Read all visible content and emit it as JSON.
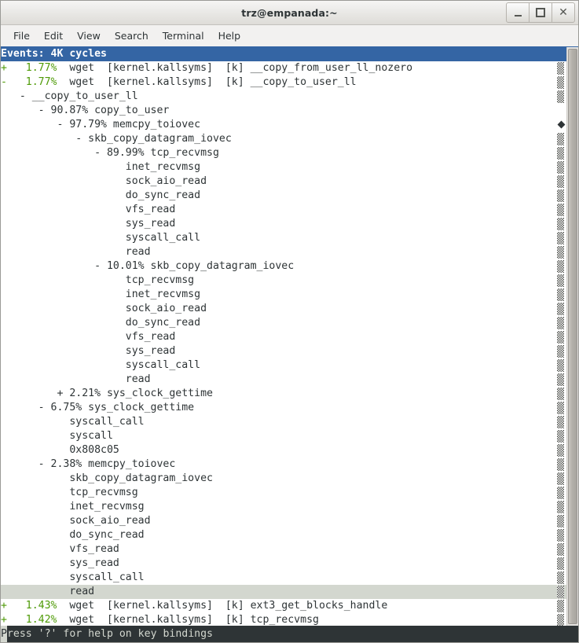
{
  "window": {
    "title": "trz@empanada:~",
    "controls": [
      {
        "name": "minimize",
        "label": "–"
      },
      {
        "name": "maximize",
        "label": "□"
      },
      {
        "name": "close",
        "label": "✕"
      }
    ]
  },
  "menubar": {
    "items": [
      "File",
      "Edit",
      "View",
      "Search",
      "Terminal",
      "Help"
    ]
  },
  "colors": {
    "header_bg": "#3465a4",
    "header_fg": "#ffffff",
    "percent_green": "#4e9a06",
    "selected_row_bg": "#d3d7cf",
    "terminal_bg": "#ffffff",
    "terminal_fg": "#2e3436",
    "statusbar_bg": "#2e3436",
    "statusbar_fg": "#d3d7cf"
  },
  "terminal": {
    "header": "Events: 4K cycles",
    "rows": [
      {
        "marker": "+",
        "percent": "1.77%",
        "text": "  wget  [kernel.kallsyms]  [k] __copy_from_user_ll_nozero",
        "indicator": "dither"
      },
      {
        "marker": "-",
        "percent": "1.77%",
        "text": "  wget  [kernel.kallsyms]  [k] __copy_to_user_ll",
        "indicator": "dither"
      },
      {
        "marker": "",
        "percent": "",
        "text": "   - __copy_to_user_ll",
        "indicator": "dither"
      },
      {
        "marker": "",
        "percent": "",
        "text": "      - 90.87% copy_to_user",
        "indicator": "none"
      },
      {
        "marker": "",
        "percent": "",
        "text": "         - 97.79% memcpy_toiovec",
        "indicator": "diamond"
      },
      {
        "marker": "",
        "percent": "",
        "text": "            - skb_copy_datagram_iovec",
        "indicator": "dither"
      },
      {
        "marker": "",
        "percent": "",
        "text": "               - 89.99% tcp_recvmsg",
        "indicator": "dither"
      },
      {
        "marker": "",
        "percent": "",
        "text": "                    inet_recvmsg",
        "indicator": "dither"
      },
      {
        "marker": "",
        "percent": "",
        "text": "                    sock_aio_read",
        "indicator": "dither"
      },
      {
        "marker": "",
        "percent": "",
        "text": "                    do_sync_read",
        "indicator": "dither"
      },
      {
        "marker": "",
        "percent": "",
        "text": "                    vfs_read",
        "indicator": "dither"
      },
      {
        "marker": "",
        "percent": "",
        "text": "                    sys_read",
        "indicator": "dither"
      },
      {
        "marker": "",
        "percent": "",
        "text": "                    syscall_call",
        "indicator": "dither"
      },
      {
        "marker": "",
        "percent": "",
        "text": "                    read",
        "indicator": "dither"
      },
      {
        "marker": "",
        "percent": "",
        "text": "               - 10.01% skb_copy_datagram_iovec",
        "indicator": "dither"
      },
      {
        "marker": "",
        "percent": "",
        "text": "                    tcp_recvmsg",
        "indicator": "dither"
      },
      {
        "marker": "",
        "percent": "",
        "text": "                    inet_recvmsg",
        "indicator": "dither"
      },
      {
        "marker": "",
        "percent": "",
        "text": "                    sock_aio_read",
        "indicator": "dither"
      },
      {
        "marker": "",
        "percent": "",
        "text": "                    do_sync_read",
        "indicator": "dither"
      },
      {
        "marker": "",
        "percent": "",
        "text": "                    vfs_read",
        "indicator": "dither"
      },
      {
        "marker": "",
        "percent": "",
        "text": "                    sys_read",
        "indicator": "dither"
      },
      {
        "marker": "",
        "percent": "",
        "text": "                    syscall_call",
        "indicator": "dither"
      },
      {
        "marker": "",
        "percent": "",
        "text": "                    read",
        "indicator": "dither"
      },
      {
        "marker": "",
        "percent": "",
        "text": "         + 2.21% sys_clock_gettime",
        "indicator": "dither"
      },
      {
        "marker": "",
        "percent": "",
        "text": "      - 6.75% sys_clock_gettime",
        "indicator": "dither"
      },
      {
        "marker": "",
        "percent": "",
        "text": "           syscall_call",
        "indicator": "dither"
      },
      {
        "marker": "",
        "percent": "",
        "text": "           syscall",
        "indicator": "dither"
      },
      {
        "marker": "",
        "percent": "",
        "text": "           0x808c05",
        "indicator": "dither"
      },
      {
        "marker": "",
        "percent": "",
        "text": "      - 2.38% memcpy_toiovec",
        "indicator": "dither"
      },
      {
        "marker": "",
        "percent": "",
        "text": "           skb_copy_datagram_iovec",
        "indicator": "dither"
      },
      {
        "marker": "",
        "percent": "",
        "text": "           tcp_recvmsg",
        "indicator": "dither"
      },
      {
        "marker": "",
        "percent": "",
        "text": "           inet_recvmsg",
        "indicator": "dither"
      },
      {
        "marker": "",
        "percent": "",
        "text": "           sock_aio_read",
        "indicator": "dither"
      },
      {
        "marker": "",
        "percent": "",
        "text": "           do_sync_read",
        "indicator": "dither"
      },
      {
        "marker": "",
        "percent": "",
        "text": "           vfs_read",
        "indicator": "dither"
      },
      {
        "marker": "",
        "percent": "",
        "text": "           sys_read",
        "indicator": "dither"
      },
      {
        "marker": "",
        "percent": "",
        "text": "           syscall_call",
        "indicator": "dither"
      },
      {
        "marker": "",
        "percent": "",
        "text": "           read",
        "indicator": "dither",
        "selected": true
      },
      {
        "marker": "+",
        "percent": "1.43%",
        "text": "  wget  [kernel.kallsyms]  [k] ext3_get_blocks_handle",
        "indicator": "dither"
      },
      {
        "marker": "+",
        "percent": "1.42%",
        "text": "  wget  [kernel.kallsyms]  [k] tcp_recvmsg",
        "indicator": "dither"
      }
    ]
  },
  "statusbar": {
    "cursor_char": "P",
    "text": "ress '?' for help on key bindings"
  }
}
